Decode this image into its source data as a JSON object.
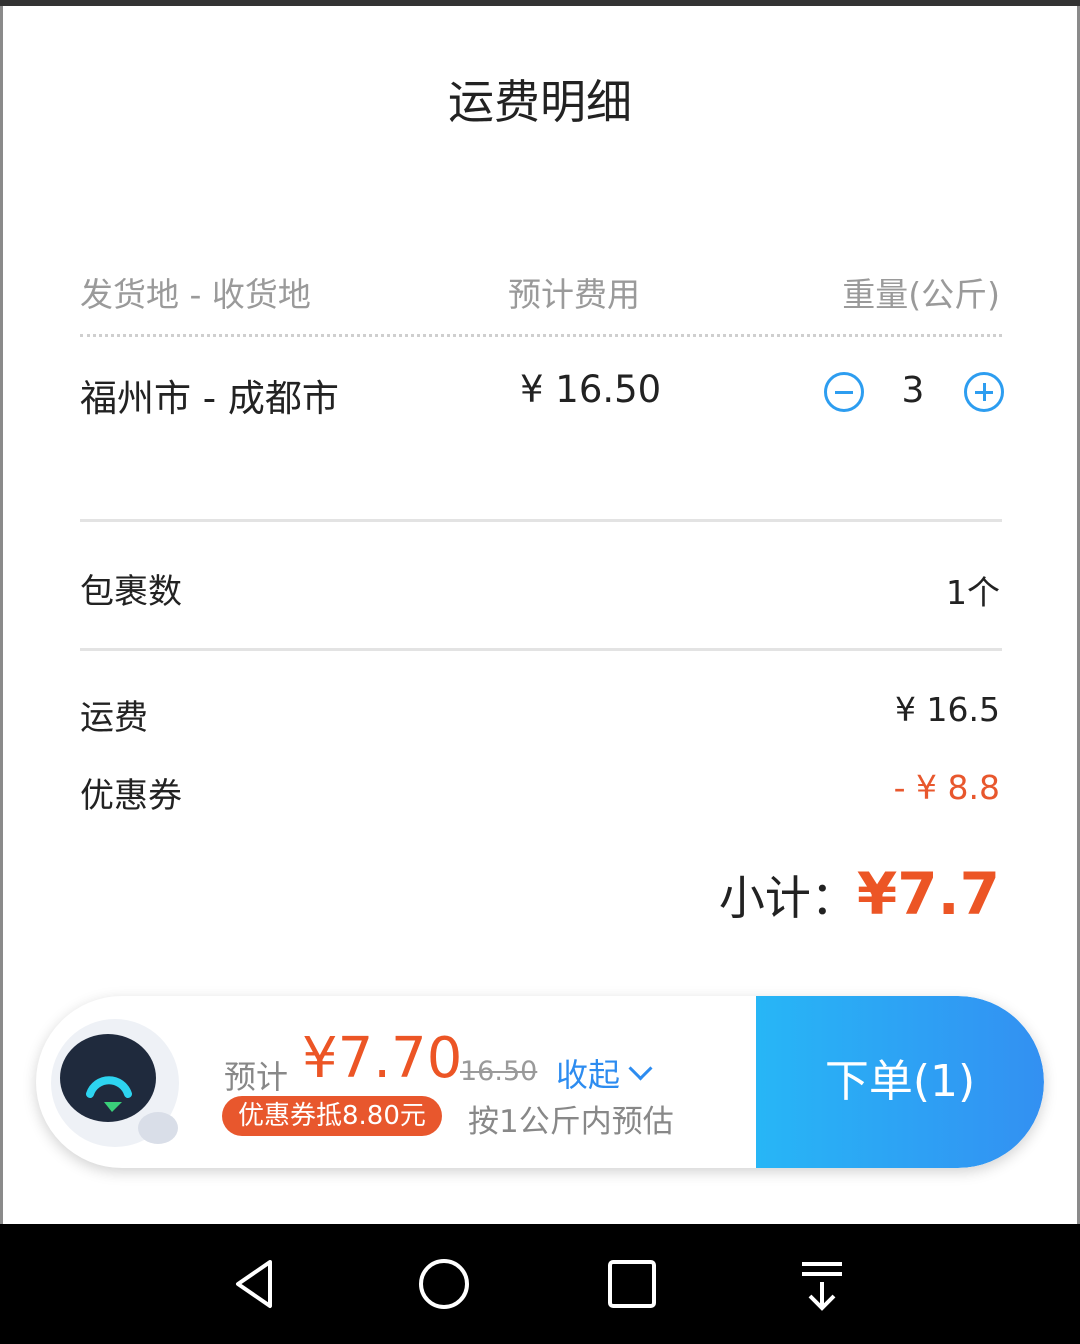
{
  "page": {
    "title": "运费明细"
  },
  "table": {
    "headers": {
      "route": "发货地 - 收货地",
      "fee": "预计费用",
      "weight": "重量(公斤)"
    },
    "rows": [
      {
        "route": "福州市 - 成都市",
        "fee": "¥ 16.50",
        "weight": "3"
      }
    ]
  },
  "summary": {
    "packages_label": "包裹数",
    "packages_value": "1个",
    "freight_label": "运费",
    "freight_value": "¥ 16.5",
    "coupon_label": "优惠券",
    "coupon_value": "- ¥ 8.8",
    "subtotal_label": "小计：",
    "subtotal_value": "¥7.7"
  },
  "bottom_bar": {
    "estimate_label": "预计",
    "estimate_price": "¥7.70",
    "original_price": "16.50",
    "collapse_label": "收起",
    "coupon_badge": "优惠券抵8.80元",
    "estimate_note": "按1公斤内预估",
    "order_button": "下单(1)"
  },
  "colors": {
    "accent_blue": "#2d9df0",
    "price_red": "#ec5525",
    "button_gradient_start": "#27b6f6",
    "button_gradient_end": "#3390f2"
  },
  "icons": [
    "minus-icon",
    "plus-icon",
    "chevron-down-icon",
    "robot-avatar-icon",
    "nav-back-icon",
    "nav-home-icon",
    "nav-recents-icon",
    "nav-notification-icon"
  ]
}
